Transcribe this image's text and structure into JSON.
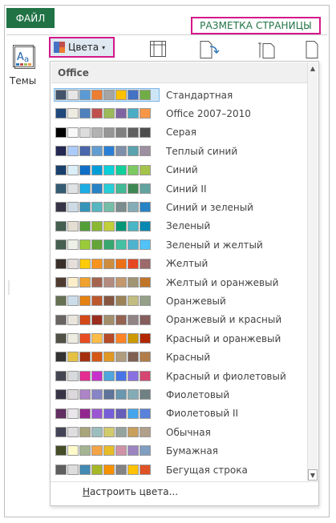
{
  "ribbon": {
    "file_tab": "ФАЙЛ",
    "layout_tab": "РАЗМЕТКА СТРАНИЦЫ",
    "themes_label": "Темы",
    "colors_label": "Цвета",
    "colors_arrow": "▾"
  },
  "dropdown": {
    "section_header": "Office",
    "customize_label": "Настроить цвета...",
    "customize_hotkey": "Н",
    "customize_rest": "астроить цвета...",
    "items": [
      {
        "label": "Стандартная",
        "colors": [
          "#44546A",
          "#E7E6E6",
          "#5B9BD5",
          "#ED7D31",
          "#A5A5A5",
          "#FFC000",
          "#4472C4",
          "#70AD47"
        ],
        "selected": true
      },
      {
        "label": "Office 2007–2010",
        "colors": [
          "#1F497D",
          "#EEECE1",
          "#4F81BD",
          "#C0504D",
          "#9BBB59",
          "#8064A2",
          "#4BACC6",
          "#F79646"
        ]
      },
      {
        "label": "Серая",
        "colors": [
          "#000000",
          "#F8F8F8",
          "#DDDDDD",
          "#B2B2B2",
          "#969696",
          "#808080",
          "#5F5F5F",
          "#4D4D4D"
        ]
      },
      {
        "label": "Теплый синий",
        "colors": [
          "#242852",
          "#ACCBF9",
          "#4A66AC",
          "#629DD1",
          "#297FD5",
          "#7F8FA9",
          "#5AA2AE",
          "#9D90A0"
        ]
      },
      {
        "label": "Синий",
        "colors": [
          "#17406D",
          "#DBEFF9",
          "#0F6FC6",
          "#009DD9",
          "#0BD0D9",
          "#10CF9B",
          "#7CCA62",
          "#A5C249"
        ]
      },
      {
        "label": "Синий II",
        "colors": [
          "#335B74",
          "#DFE3E5",
          "#1CADE4",
          "#2683C6",
          "#27CED7",
          "#42BA97",
          "#3E8853",
          "#62A39F"
        ]
      },
      {
        "label": "Синий и зеленый",
        "colors": [
          "#373545",
          "#CEDBE6",
          "#3494BA",
          "#58B6C0",
          "#75BDA7",
          "#7A8C8E",
          "#84ACB6",
          "#2683C6"
        ]
      },
      {
        "label": "Зеленый",
        "colors": [
          "#455F51",
          "#E3DED1",
          "#549E39",
          "#8AB833",
          "#C0CF3A",
          "#029676",
          "#4AB5C4",
          "#0989B1"
        ]
      },
      {
        "label": "Зеленый и желтый",
        "colors": [
          "#455F51",
          "#EDF1E8",
          "#99CB38",
          "#63A537",
          "#37A76F",
          "#44C1A3",
          "#4EB3CF",
          "#51C3F9"
        ]
      },
      {
        "label": "Желтый",
        "colors": [
          "#39302A",
          "#E5DEDB",
          "#FFCA08",
          "#F8931D",
          "#CE8D3E",
          "#EC7016",
          "#E64823",
          "#9C6A6A"
        ]
      },
      {
        "label": "Желтый и оранжевый",
        "colors": [
          "#4E3B30",
          "#FBEEC9",
          "#F0A22E",
          "#A5644E",
          "#B58B80",
          "#C3986D",
          "#A19574",
          "#C17529"
        ]
      },
      {
        "label": "Оранжевый",
        "colors": [
          "#637052",
          "#CCDDEA",
          "#E48312",
          "#BD582C",
          "#865640",
          "#9B8357",
          "#C2BC80",
          "#94A088"
        ]
      },
      {
        "label": "Оранжевый и красный",
        "colors": [
          "#696464",
          "#E9E5DC",
          "#D34817",
          "#9B2D1F",
          "#A28E6A",
          "#956251",
          "#918485",
          "#855D5D"
        ]
      },
      {
        "label": "Красный и оранжевый",
        "colors": [
          "#505046",
          "#EEECE1",
          "#E84C22",
          "#FFBD47",
          "#B64926",
          "#FF8427",
          "#CC9900",
          "#B22600"
        ]
      },
      {
        "label": "Красный",
        "colors": [
          "#323232",
          "#E5C243",
          "#A5300F",
          "#D55816",
          "#E19825",
          "#B19C7D",
          "#7F5F52",
          "#B27D49"
        ]
      },
      {
        "label": "Красный и фиолетовый",
        "colors": [
          "#454551",
          "#D8D9DC",
          "#E32D91",
          "#C830CC",
          "#4EA6DC",
          "#4775E7",
          "#8971E1",
          "#D54773"
        ]
      },
      {
        "label": "Фиолетовый",
        "colors": [
          "#373545",
          "#DCD8DC",
          "#AD84C6",
          "#8784C7",
          "#5D739A",
          "#6997AF",
          "#84ACB6",
          "#6F8183"
        ]
      },
      {
        "label": "Фиолетовый II",
        "colors": [
          "#632E62",
          "#EAE5EB",
          "#92278F",
          "#9B57D3",
          "#755DD9",
          "#665EB8",
          "#45A5ED",
          "#5982DB"
        ]
      },
      {
        "label": "Обычная",
        "colors": [
          "#424456",
          "#DEDEE0",
          "#A9A57C",
          "#9CBEBD",
          "#D2CB6C",
          "#95A39D",
          "#C89F5D",
          "#B1A089"
        ]
      },
      {
        "label": "Бумажная",
        "colors": [
          "#444D26",
          "#FEFAC9",
          "#A5B592",
          "#F3A447",
          "#E7BC29",
          "#D092A7",
          "#9C85C0",
          "#809EC2"
        ]
      },
      {
        "label": "Бегущая строка",
        "colors": [
          "#5E5E5E",
          "#DDDDDD",
          "#418AB3",
          "#A6B727",
          "#F69200",
          "#838383",
          "#FEC306",
          "#DF5327"
        ]
      }
    ]
  }
}
